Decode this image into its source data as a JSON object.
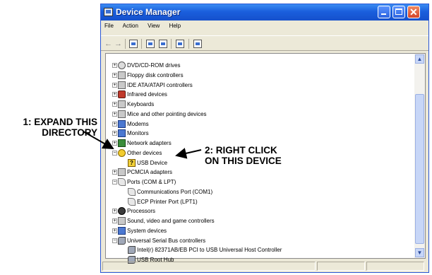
{
  "window": {
    "title": "Device Manager"
  },
  "menu": [
    "File",
    "Action",
    "View",
    "Help"
  ],
  "tree": [
    {
      "label": "DVD/CD-ROM drives",
      "icon": "disk-drive-icon",
      "expander": "+"
    },
    {
      "label": "Floppy disk controllers",
      "icon": "floppy-controller-icon",
      "expander": "+"
    },
    {
      "label": "IDE ATA/ATAPI controllers",
      "icon": "ide-controller-icon",
      "expander": "+"
    },
    {
      "label": "Infrared devices",
      "icon": "infrared-icon",
      "expander": "+"
    },
    {
      "label": "Keyboards",
      "icon": "keyboard-icon",
      "expander": "+"
    },
    {
      "label": "Mice and other pointing devices",
      "icon": "mouse-icon",
      "expander": "+"
    },
    {
      "label": "Modems",
      "icon": "modem-icon",
      "expander": "+"
    },
    {
      "label": "Monitors",
      "icon": "monitor-icon",
      "expander": "+"
    },
    {
      "label": "Network adapters",
      "icon": "network-adapter-icon",
      "expander": "+"
    },
    {
      "label": "Other devices",
      "icon": "other-devices-icon",
      "expander": "−"
    },
    {
      "label": "USB Device",
      "icon": "warning-device-icon",
      "child": true
    },
    {
      "label": "PCMCIA adapters",
      "icon": "pcmcia-icon",
      "expander": "+"
    },
    {
      "label": "Ports (COM & LPT)",
      "icon": "port-icon",
      "expander": "−"
    },
    {
      "label": "Communications Port (COM1)",
      "icon": "port-icon",
      "child": true
    },
    {
      "label": "ECP Printer Port (LPT1)",
      "icon": "port-icon",
      "child": true
    },
    {
      "label": "Processors",
      "icon": "processor-icon",
      "expander": "+"
    },
    {
      "label": "Sound, video and game controllers",
      "icon": "sound-icon",
      "expander": "+"
    },
    {
      "label": "System devices",
      "icon": "system-devices-icon",
      "expander": "+"
    },
    {
      "label": "Universal Serial Bus controllers",
      "icon": "usb-icon",
      "expander": "−"
    },
    {
      "label": "Intel(r) 82371AB/EB PCI to USB Universal Host Controller",
      "icon": "usb-icon",
      "child": true
    },
    {
      "label": "USB Root Hub",
      "icon": "usb-icon",
      "child": true
    }
  ],
  "annotations": {
    "step1_line1": "1: EXPAND THIS",
    "step1_line2": "DIRECTORY",
    "step2_line1": "2: RIGHT CLICK",
    "step2_line2": "ON THIS DEVICE"
  }
}
